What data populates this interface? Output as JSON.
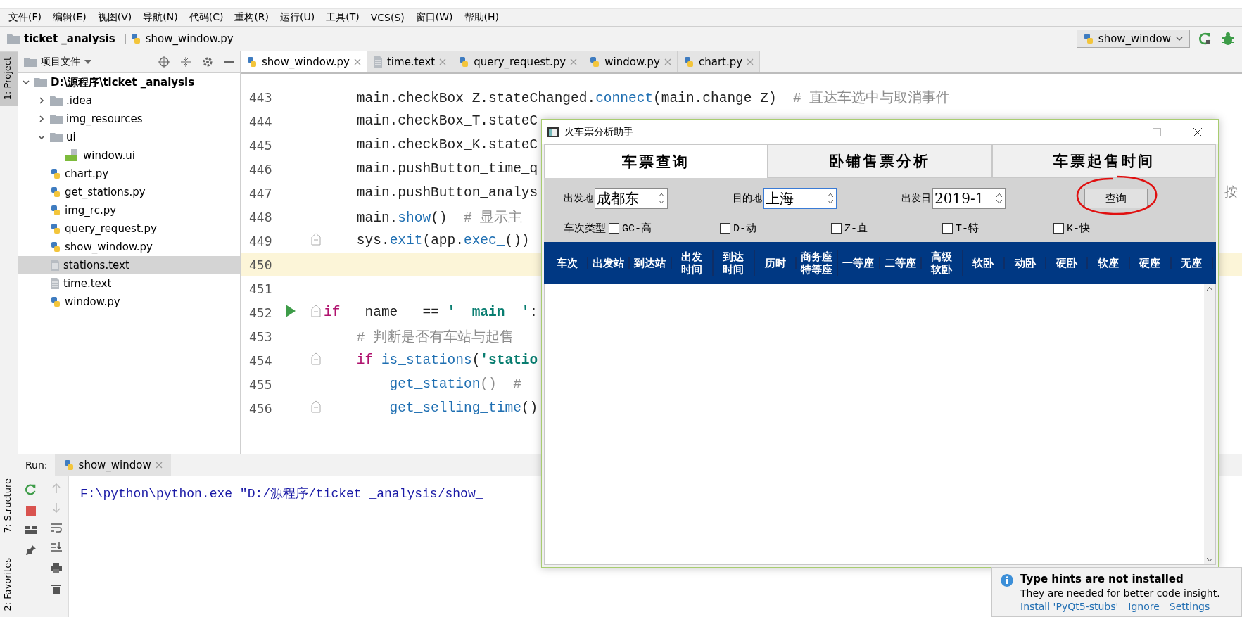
{
  "menu": [
    "文件(F)",
    "编辑(E)",
    "视图(V)",
    "导航(N)",
    "代码(C)",
    "重构(R)",
    "运行(U)",
    "工具(T)",
    "VCS(S)",
    "窗口(W)",
    "帮助(H)"
  ],
  "breadcrumb": [
    {
      "label": "ticket _analysis",
      "kind": "folder"
    },
    {
      "label": "show_window.py",
      "kind": "python"
    }
  ],
  "run_config": {
    "label": "show_window"
  },
  "side_tabs": {
    "top": [
      {
        "label": "1: Project",
        "selected": true
      }
    ],
    "bottom": [
      {
        "label": "7: Structure",
        "selected": false
      },
      {
        "label": "2: Favorites",
        "selected": false
      }
    ]
  },
  "project": {
    "title": "项目文件",
    "tree": [
      {
        "label": "D:\\源程序\\ticket _analysis",
        "kind": "folder",
        "expanded": true,
        "selected": false,
        "children": [
          {
            "label": ".idea",
            "kind": "folder",
            "expanded": false,
            "selected": false
          },
          {
            "label": "img_resources",
            "kind": "folder",
            "expanded": false,
            "selected": false
          },
          {
            "label": "ui",
            "kind": "folder",
            "expanded": true,
            "selected": false,
            "children": [
              {
                "label": "window.ui",
                "kind": "qt",
                "selected": false
              }
            ]
          },
          {
            "label": "chart.py",
            "kind": "python",
            "selected": false
          },
          {
            "label": "get_stations.py",
            "kind": "python",
            "selected": false
          },
          {
            "label": "img_rc.py",
            "kind": "python",
            "selected": false
          },
          {
            "label": "query_request.py",
            "kind": "python",
            "selected": false
          },
          {
            "label": "show_window.py",
            "kind": "python",
            "selected": false
          },
          {
            "label": "stations.text",
            "kind": "text",
            "selected": true
          },
          {
            "label": "time.text",
            "kind": "text",
            "selected": false
          },
          {
            "label": "window.py",
            "kind": "python",
            "selected": false
          }
        ]
      }
    ]
  },
  "editor_tabs": [
    {
      "label": "show_window.py",
      "kind": "python",
      "selected": true
    },
    {
      "label": "time.text",
      "kind": "text",
      "selected": false
    },
    {
      "label": "query_request.py",
      "kind": "python",
      "selected": false
    },
    {
      "label": "window.py",
      "kind": "python",
      "selected": false
    },
    {
      "label": "chart.py",
      "kind": "python",
      "selected": false
    }
  ],
  "code": [
    {
      "number": "443",
      "current": false,
      "runnable": false,
      "fold": false,
      "tokens": [
        {
          "text": "    main.checkBox_Z.stateChanged.",
          "kind": "plain"
        },
        {
          "text": "connect",
          "kind": "call"
        },
        {
          "text": "(main.change_Z)  ",
          "kind": "plain"
        },
        {
          "text": "# 直达车选中与取消事件",
          "kind": "comment"
        }
      ]
    },
    {
      "number": "444",
      "current": false,
      "runnable": false,
      "fold": false,
      "tokens": [
        {
          "text": "    main.checkBox_T.stateC",
          "kind": "plain"
        }
      ]
    },
    {
      "number": "445",
      "current": false,
      "runnable": false,
      "fold": false,
      "tokens": [
        {
          "text": "    main.checkBox_K.stateC",
          "kind": "plain"
        }
      ]
    },
    {
      "number": "446",
      "current": false,
      "runnable": false,
      "fold": false,
      "tokens": [
        {
          "text": "    main.pushButton_time_q",
          "kind": "plain"
        }
      ]
    },
    {
      "number": "447",
      "current": false,
      "runnable": false,
      "fold": false,
      "tokens": [
        {
          "text": "    main.pushButton_analys",
          "kind": "plain"
        }
      ]
    },
    {
      "number": "448",
      "current": false,
      "runnable": false,
      "fold": false,
      "tokens": [
        {
          "text": "    main.",
          "kind": "plain"
        },
        {
          "text": "show",
          "kind": "call"
        },
        {
          "text": "()  ",
          "kind": "plain"
        },
        {
          "text": "# 显示主",
          "kind": "comment"
        }
      ]
    },
    {
      "number": "449",
      "current": false,
      "runnable": false,
      "fold": true,
      "tokens": [
        {
          "text": "    sys.",
          "kind": "plain"
        },
        {
          "text": "exit",
          "kind": "call"
        },
        {
          "text": "(app.",
          "kind": "plain"
        },
        {
          "text": "exec_",
          "kind": "call"
        },
        {
          "text": "())",
          "kind": "plain"
        }
      ]
    },
    {
      "number": "450",
      "current": true,
      "runnable": false,
      "fold": false
    },
    {
      "number": "451",
      "current": false,
      "runnable": false,
      "fold": false
    },
    {
      "number": "452",
      "current": false,
      "runnable": true,
      "fold": true,
      "tokens": [
        {
          "text": "if",
          "kind": "keyword"
        },
        {
          "text": " __name__ == ",
          "kind": "plain"
        },
        {
          "text": "'__main__'",
          "kind": "string"
        },
        {
          "text": ":",
          "kind": "plain"
        }
      ]
    },
    {
      "number": "453",
      "current": false,
      "runnable": false,
      "fold": false,
      "tokens": [
        {
          "text": "    # 判断是否有车站与起售",
          "kind": "comment"
        }
      ]
    },
    {
      "number": "454",
      "current": false,
      "runnable": false,
      "fold": true,
      "tokens": [
        {
          "text": "    if",
          "kind": "keyword"
        },
        {
          "text": " is_stations",
          "kind": "call"
        },
        {
          "text": "(",
          "kind": "plain"
        },
        {
          "text": "'statio",
          "kind": "string"
        }
      ]
    },
    {
      "number": "455",
      "current": false,
      "runnable": false,
      "fold": false,
      "tokens": [
        {
          "text": "        get_station",
          "kind": "call"
        },
        {
          "text": "()  #",
          "kind": "comment"
        }
      ]
    },
    {
      "number": "456",
      "current": false,
      "runnable": false,
      "fold": true,
      "tokens": [
        {
          "text": "        get_selling_time",
          "kind": "call"
        },
        {
          "text": "()",
          "kind": "plain"
        }
      ]
    }
  ],
  "code_overflow_text": "按",
  "run": {
    "label": "Run:",
    "tab": "show_window",
    "output": "F:\\python\\python.exe \"D:/源程序/ticket _analysis/show_"
  },
  "dialog": {
    "title": "火车票分析助手",
    "tabs": [
      {
        "label": "车票查询",
        "selected": true
      },
      {
        "label": "卧铺售票分析",
        "selected": false
      },
      {
        "label": "车票起售时间",
        "selected": false
      }
    ],
    "fields": [
      {
        "label": "出发地",
        "value": "成都东",
        "focused": false
      },
      {
        "label": "目的地",
        "value": "上海",
        "focused": true
      },
      {
        "label": "出发日",
        "value": "2019-1",
        "focused": false
      }
    ],
    "query_button": {
      "label": "查询",
      "circled": true
    },
    "train_type_label": "车次类型",
    "train_types": [
      {
        "label": "GC-高",
        "checked": false
      },
      {
        "label": "D-动",
        "checked": false
      },
      {
        "label": "Z-直",
        "checked": false
      },
      {
        "label": "T-特",
        "checked": false
      },
      {
        "label": "K-快",
        "checked": false
      }
    ],
    "columns": [
      [
        "车次"
      ],
      [
        "出发站"
      ],
      [
        "到达站"
      ],
      [
        "出发",
        "时间"
      ],
      [
        "到达",
        "时间"
      ],
      [
        "历时"
      ],
      [
        "商务座",
        "特等座"
      ],
      [
        "一等座"
      ],
      [
        "二等座"
      ],
      [
        "高级",
        "软卧"
      ],
      [
        "软卧"
      ],
      [
        "动卧"
      ],
      [
        "硬卧"
      ],
      [
        "软座"
      ],
      [
        "硬座"
      ],
      [
        "无座"
      ]
    ]
  },
  "notification": {
    "title": "Type hints are not installed",
    "body": "They are needed for better code insight.",
    "links": [
      "Install 'PyQt5-stubs'",
      "Ignore",
      "Settings"
    ]
  }
}
